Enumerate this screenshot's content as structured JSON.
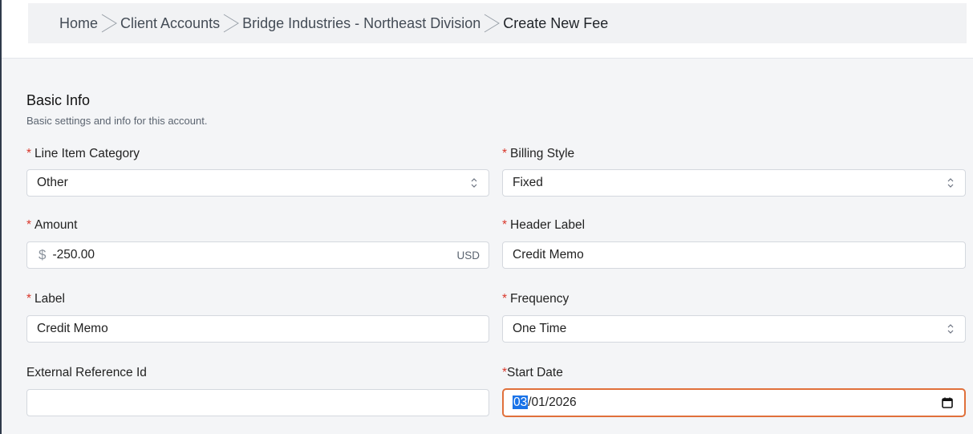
{
  "breadcrumb": {
    "items": [
      "Home",
      "Client Accounts",
      "Bridge Industries - Northeast Division",
      "Create New Fee"
    ]
  },
  "section": {
    "title": "Basic Info",
    "subtitle": "Basic settings and info for this account."
  },
  "required_marker": "*",
  "fields": {
    "line_item_category": {
      "label": "Line Item Category",
      "value": "Other"
    },
    "billing_style": {
      "label": "Billing Style",
      "value": "Fixed"
    },
    "amount": {
      "label": "Amount",
      "currency_symbol": "$",
      "value": "-250.00",
      "currency_code": "USD"
    },
    "header_label": {
      "label": "Header Label",
      "value": "Credit Memo"
    },
    "label": {
      "label": "Label",
      "value": "Credit Memo"
    },
    "frequency": {
      "label": "Frequency",
      "value": "One Time"
    },
    "external_reference_id": {
      "label": "External Reference Id",
      "value": ""
    },
    "start_date": {
      "label": "Start Date",
      "month": "03",
      "rest": "/01/2026"
    }
  },
  "colors": {
    "required": "#d9372b",
    "focus_border": "#e0703b",
    "selection": "#1a73e8"
  },
  "icons": [
    "chevron-right-icon",
    "up-down-chevron-icon",
    "calendar-icon"
  ]
}
